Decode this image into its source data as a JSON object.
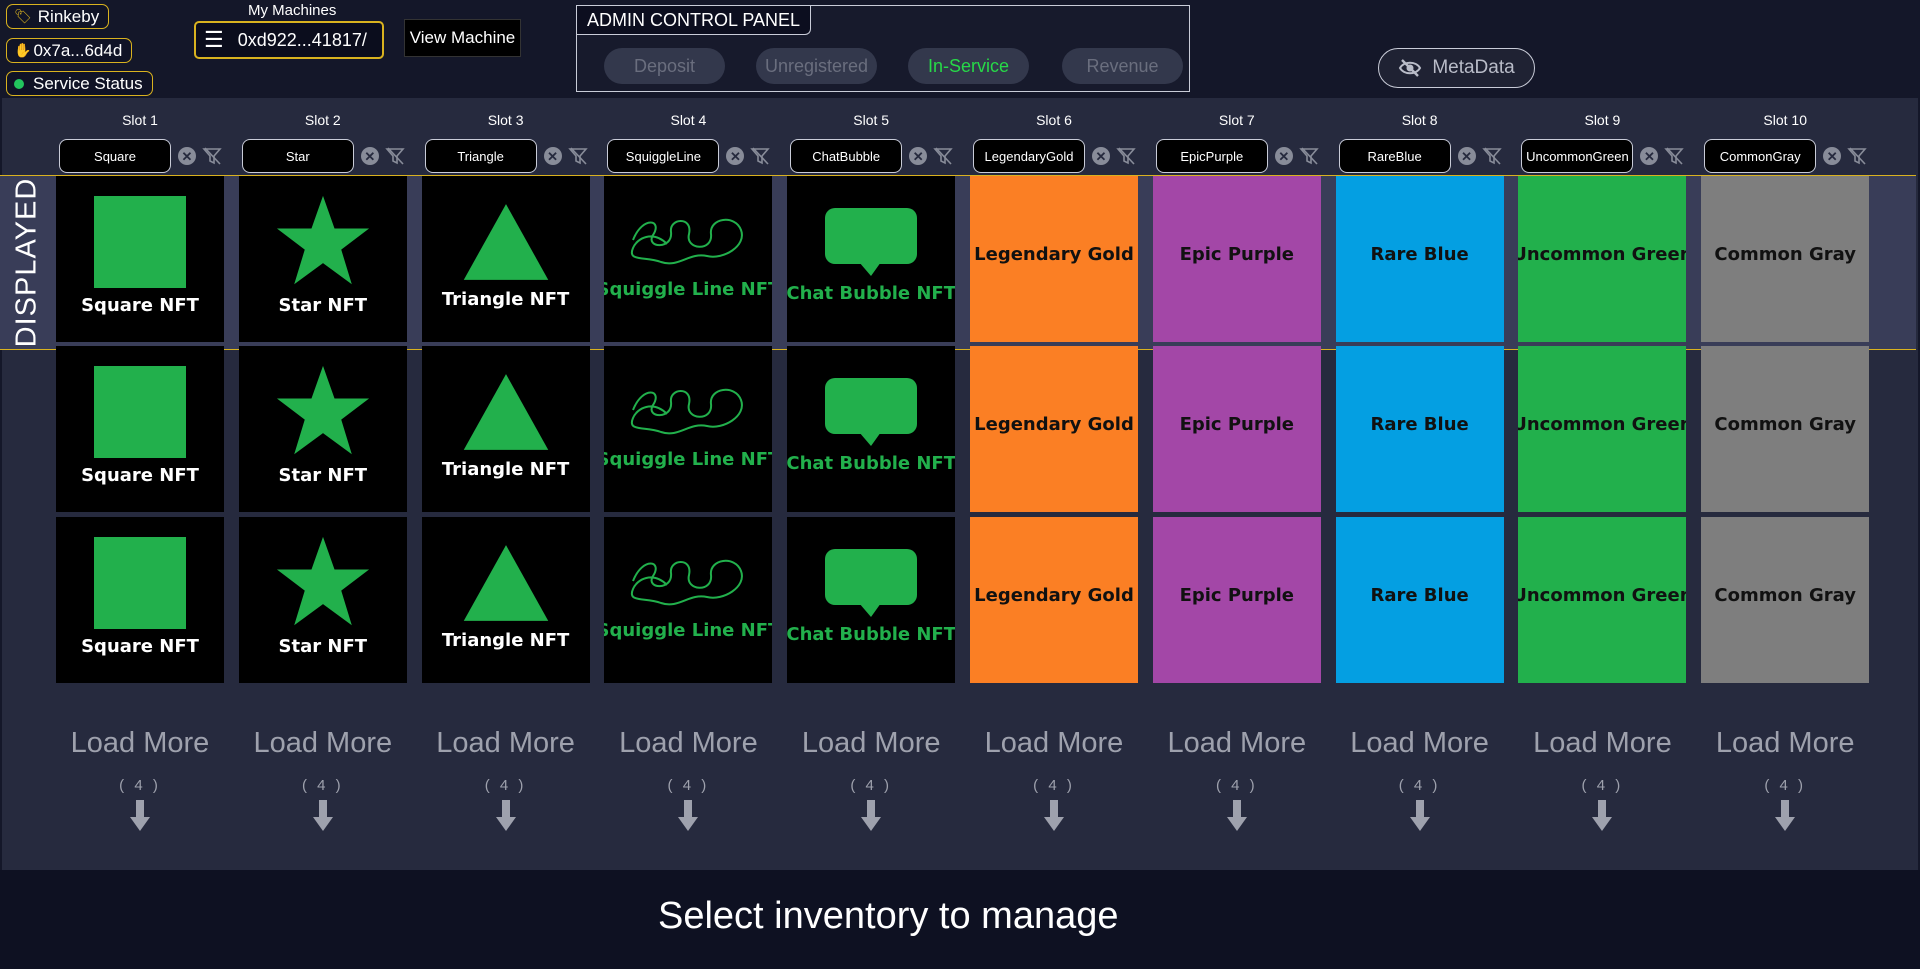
{
  "header": {
    "network_label": "Rinkeby",
    "wallet_label": "0x7a...6d4d",
    "service_status_label": "Service Status",
    "machines_label": "My Machines",
    "machine_value": "0xd922...41817/",
    "view_machine_label": "View Machine"
  },
  "admin_panel": {
    "title": "ADMIN CONTROL PANEL",
    "tabs": [
      {
        "label": "Deposit",
        "active": false
      },
      {
        "label": "Unregistered",
        "active": false
      },
      {
        "label": "In-Service",
        "active": true
      },
      {
        "label": "Revenue",
        "active": false
      }
    ]
  },
  "metadata_label": "MetaData",
  "displayed_label": "DISPLAYED",
  "slots": [
    {
      "label": "Slot 1",
      "filter": "Square",
      "card": "Square NFT",
      "kind": "square"
    },
    {
      "label": "Slot 2",
      "filter": "Star",
      "card": "Star NFT",
      "kind": "star"
    },
    {
      "label": "Slot 3",
      "filter": "Triangle",
      "card": "Triangle NFT",
      "kind": "triangle"
    },
    {
      "label": "Slot 4",
      "filter": "SquiggleLine",
      "card": "Squiggle Line NFT",
      "kind": "squiggle"
    },
    {
      "label": "Slot 5",
      "filter": "ChatBubble",
      "card": "Chat Bubble NFT",
      "kind": "chat"
    },
    {
      "label": "Slot 6",
      "filter": "LegendaryGold",
      "card": "Legendary Gold",
      "kind": "color",
      "color": "#fb7f24"
    },
    {
      "label": "Slot 7",
      "filter": "EpicPurple",
      "card": "Epic Purple",
      "kind": "color",
      "color": "#a347a7"
    },
    {
      "label": "Slot 8",
      "filter": "RareBlue",
      "card": "Rare Blue",
      "kind": "color",
      "color": "#049fe2"
    },
    {
      "label": "Slot 9",
      "filter": "UncommonGreen",
      "card": "Uncommon Green",
      "kind": "color",
      "color": "#22b04c"
    },
    {
      "label": "Slot 10",
      "filter": "CommonGray",
      "card": "Common Gray",
      "kind": "color",
      "color": "#7e7e7e"
    }
  ],
  "load_more_label": "Load More",
  "load_more_count": "( 4 )",
  "footer_text": "Select inventory to manage",
  "colors": {
    "accent_gold": "#d9b21f",
    "nft_green": "#22b04c",
    "active_tab_text": "#27d948"
  }
}
